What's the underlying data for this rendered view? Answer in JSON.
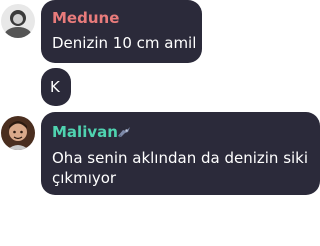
{
  "messages": [
    {
      "sender": "Medune",
      "sender_color": "#e87b7b",
      "text": "Denizin 10 cm amil",
      "avatar_icon": "user-avatar-photo"
    },
    {
      "text": "K"
    },
    {
      "sender": "Malivan",
      "sender_color": "#4fd3b0",
      "badge_icon": "spaceship-icon",
      "text": "Oha senin aklından da denizin siki çıkmıyor",
      "avatar_icon": "user-avatar-photo"
    }
  ],
  "colors": {
    "bubble": "#2b2a3a",
    "background": "#ffffff",
    "text": "#ffffff"
  }
}
